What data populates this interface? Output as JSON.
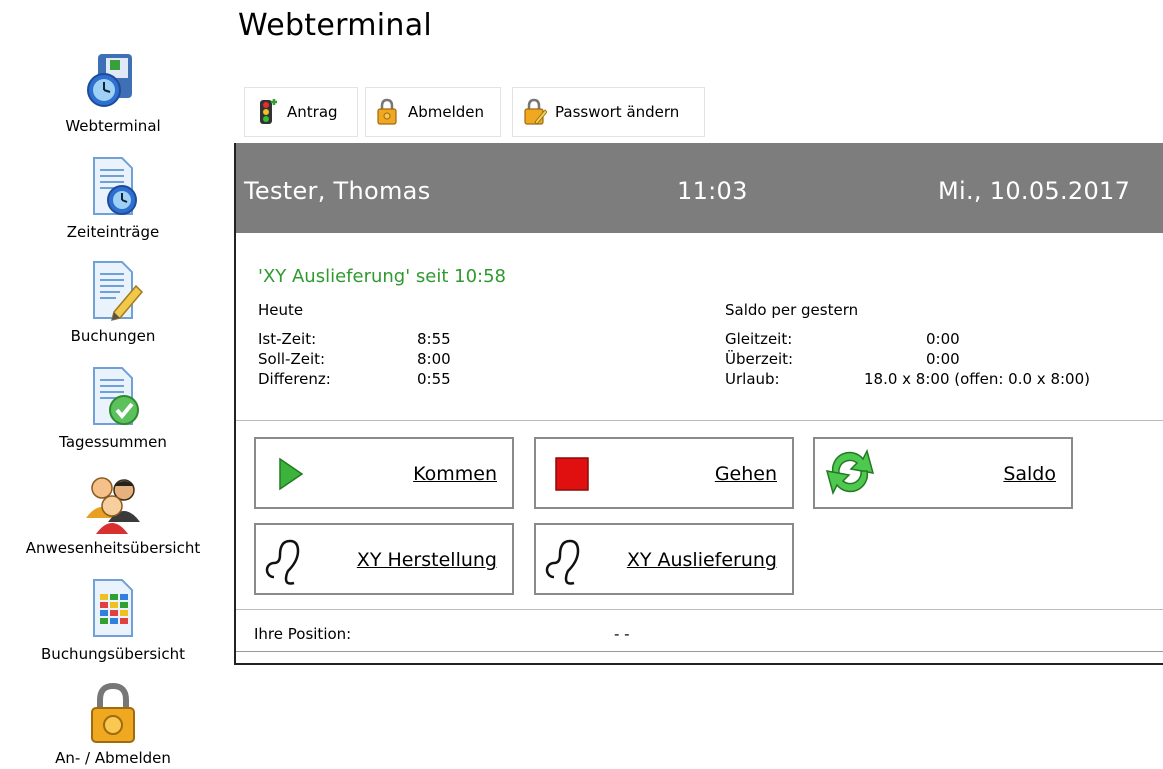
{
  "sidebar": {
    "items": [
      {
        "label": "Webterminal",
        "icon": "webterminal-icon"
      },
      {
        "label": "Zeiteinträge",
        "icon": "time-entries-icon"
      },
      {
        "label": "Buchungen",
        "icon": "bookings-icon"
      },
      {
        "label": "Tagessummen",
        "icon": "daily-totals-icon"
      },
      {
        "label": "Anwesenheitsübersicht",
        "icon": "attendance-icon"
      },
      {
        "label": "Buchungsübersicht",
        "icon": "booking-overview-icon"
      },
      {
        "label": "An- / Abmelden",
        "icon": "lock-icon"
      }
    ]
  },
  "page": {
    "title": "Webterminal"
  },
  "toolbar": {
    "antrag": "Antrag",
    "abmelden": "Abmelden",
    "passwort": "Passwort ändern"
  },
  "header": {
    "name": "Tester, Thomas",
    "time": "11:03",
    "date": "Mi., 10.05.2017"
  },
  "status": {
    "current": "'XY Auslieferung' seit 10:58"
  },
  "today": {
    "heading": "Heute",
    "rows": [
      {
        "label": "Ist-Zeit:",
        "value": "8:55"
      },
      {
        "label": "Soll-Zeit:",
        "value": "8:00"
      },
      {
        "label": "Differenz:",
        "value": "0:55"
      }
    ]
  },
  "saldo": {
    "heading": "Saldo per gestern",
    "rows": [
      {
        "label": "Gleitzeit:",
        "value": "0:00"
      },
      {
        "label": "Überzeit:",
        "value": "0:00"
      },
      {
        "label": "Urlaub:",
        "value": "18.0 x 8:00 (offen: 0.0 x 8:00)"
      }
    ]
  },
  "actions": {
    "kommen": "Kommen",
    "gehen": "Gehen",
    "saldo": "Saldo",
    "herstellung": "XY Herstellung",
    "auslieferung": "XY Auslieferung"
  },
  "position": {
    "label": "Ihre Position:",
    "value": "- -"
  },
  "colors": {
    "header_bg": "#7d7d7d",
    "status_green": "#2f9a2f",
    "play_green": "#3cb43c",
    "stop_red": "#e01010"
  }
}
